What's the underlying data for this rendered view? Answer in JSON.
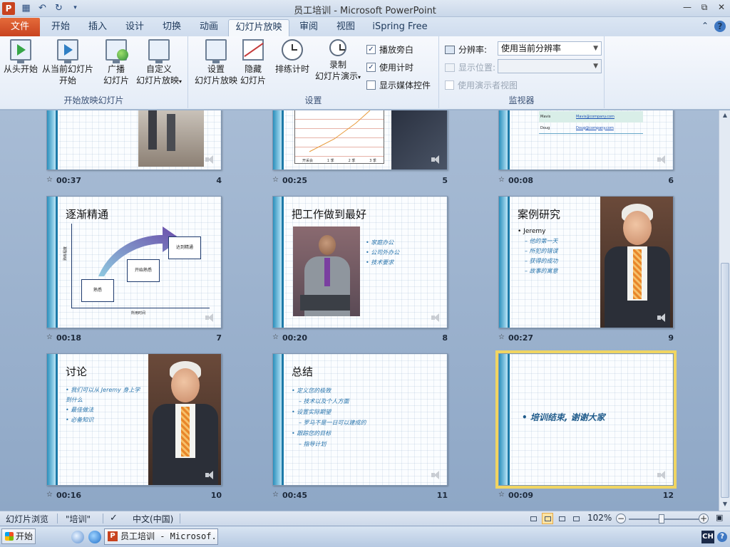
{
  "window": {
    "app_icon": "P",
    "title": "员工培训 - Microsoft PowerPoint",
    "qat_icons": [
      "save-icon",
      "undo-icon",
      "redo-icon",
      "customize-icon"
    ],
    "controls": [
      "minimize-icon",
      "restore-icon",
      "close-icon"
    ]
  },
  "tabs": {
    "file": "文件",
    "items": [
      "开始",
      "插入",
      "设计",
      "切换",
      "动画",
      "幻灯片放映",
      "审阅",
      "视图",
      "iSpring Free"
    ],
    "active": "幻灯片放映"
  },
  "ribbon": {
    "group_start": {
      "label": "开始放映幻灯片",
      "from_beginning": "从头开始",
      "from_current_1": "从当前幻灯片",
      "from_current_2": "开始",
      "broadcast_1": "广播",
      "broadcast_2": "幻灯片",
      "custom_1": "自定义",
      "custom_2": "幻灯片放映"
    },
    "group_setup": {
      "label": "设置",
      "setup_1": "设置",
      "setup_2": "幻灯片放映",
      "hide_1": "隐藏",
      "hide_2": "幻灯片",
      "rehearse": "排练计时",
      "record_1": "录制",
      "record_2": "幻灯片演示",
      "cb_narration": "播放旁白",
      "cb_timings": "使用计时",
      "cb_media": "显示媒体控件"
    },
    "group_monitor": {
      "label": "监视器",
      "resolution_label": "分辨率:",
      "resolution_value": "使用当前分辨率",
      "show_on_label": "显示位置:",
      "show_on_value": "",
      "presenter_view": "使用演示者视图"
    }
  },
  "slides": [
    {
      "num": "4",
      "time": "00:37"
    },
    {
      "num": "5",
      "time": "00:25",
      "chart_labels": [
        "开采会",
        "1 季",
        "2 季",
        "3 季"
      ]
    },
    {
      "num": "6",
      "time": "00:08",
      "rows": [
        [
          "Mavis",
          "Mavis@company.com"
        ],
        [
          "Doug",
          "Doug@company.com"
        ]
      ]
    },
    {
      "num": "7",
      "time": "00:18",
      "title": "逐渐精通",
      "boxes": [
        "熟悉",
        "开始熟悉",
        "达到精通"
      ],
      "yaxis": "熟练程度",
      "xaxis": "所用时间"
    },
    {
      "num": "8",
      "time": "00:20",
      "title": "把工作做到最好",
      "bullets": [
        "家庭办公",
        "公司外办公",
        "技术要求"
      ]
    },
    {
      "num": "9",
      "time": "00:27",
      "title": "案例研究",
      "bullets": [
        "Jeremy"
      ],
      "subs": [
        "他的第一天",
        "所犯的错误",
        "获得的成功",
        "故事的寓意"
      ]
    },
    {
      "num": "10",
      "time": "00:16",
      "title": "讨论",
      "bullets": [
        "我们可以从 Jeremy 身上学到什么",
        "最佳做法",
        "必备知识"
      ]
    },
    {
      "num": "11",
      "time": "00:45",
      "title": "总结",
      "items": [
        {
          "t": "定义您的极致",
          "s": "技术以及个人方面"
        },
        {
          "t": "设置实际期望",
          "s": "罗马不是一日可以建成的"
        },
        {
          "t": "跟踪您的目标",
          "s": "指导计划"
        }
      ]
    },
    {
      "num": "12",
      "time": "00:09",
      "bullets": [
        "培训结束, 谢谢大家"
      ],
      "selected": true
    }
  ],
  "statusbar": {
    "view": "幻灯片浏览",
    "theme": "\"培训\"",
    "language": "中文(中国)",
    "zoom": "102%",
    "zoom_fraction": 0.47
  },
  "taskbar": {
    "start": "开始",
    "task": "员工培训 - Microsof...",
    "ime": "CH"
  }
}
